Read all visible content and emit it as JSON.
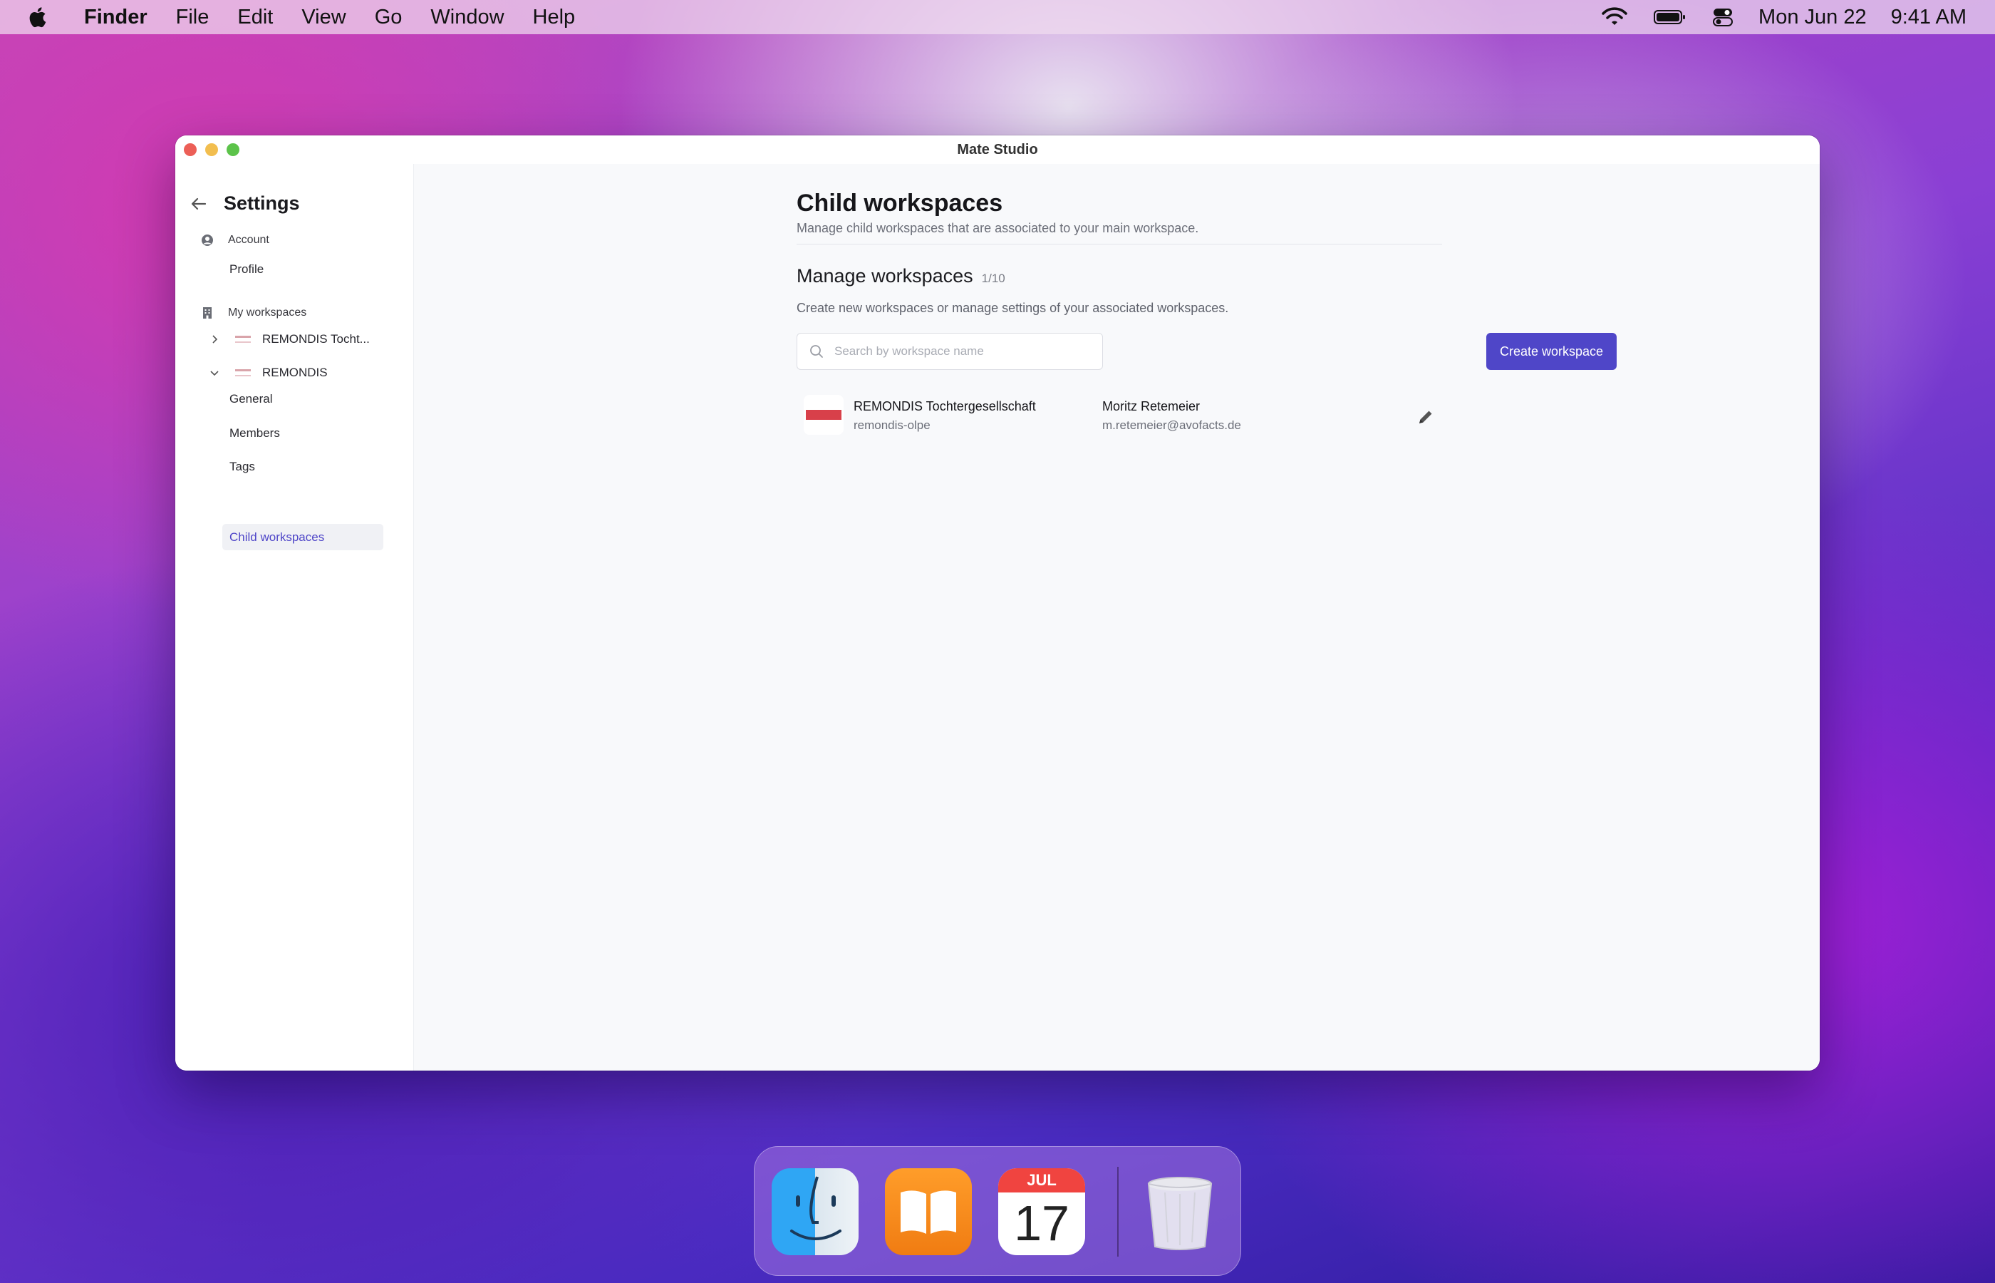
{
  "menubar": {
    "app_name": "Finder",
    "items": [
      "File",
      "Edit",
      "View",
      "Go",
      "Window",
      "Help"
    ],
    "date": "Mon Jun 22",
    "time": "9:41 AM"
  },
  "window": {
    "title": "Mate Studio"
  },
  "sidebar": {
    "title": "Settings",
    "account_section": "Account",
    "profile": "Profile",
    "workspaces_section": "My workspaces",
    "workspace_1": "REMONDIS Tocht...",
    "workspace_2": "REMONDIS",
    "sub_items": {
      "general": "General",
      "members": "Members",
      "tags": "Tags",
      "child_workspaces": "Child workspaces"
    }
  },
  "main": {
    "heading": "Child workspaces",
    "subheading": "Manage child workspaces that are associated to your main workspace.",
    "section_title": "Manage workspaces",
    "section_count": "1/10",
    "section_desc": "Create new workspaces or manage settings of your associated workspaces.",
    "search_placeholder": "Search by workspace name",
    "create_button": "Create workspace",
    "rows": [
      {
        "name": "REMONDIS Tochtergesellschaft",
        "slug": "remondis-olpe",
        "owner": "Moritz Retemeier",
        "email": "m.retemeier@avofacts.de"
      }
    ]
  },
  "dock": {
    "calendar_month": "JUL",
    "calendar_day": "17"
  },
  "colors": {
    "accent": "#4f46c8",
    "active_text": "#4f46c8"
  }
}
